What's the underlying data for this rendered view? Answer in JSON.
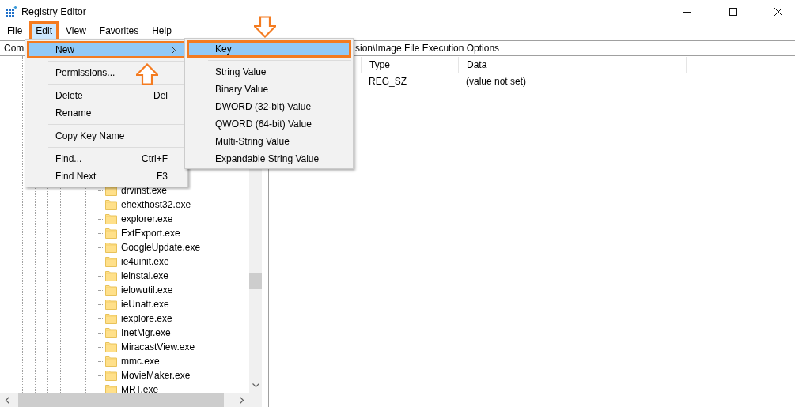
{
  "window": {
    "title": "Registry Editor"
  },
  "menu_bar": [
    {
      "label": "File",
      "selected": false,
      "annotated": false
    },
    {
      "label": "Edit",
      "selected": true,
      "annotated": true
    },
    {
      "label": "View",
      "selected": false,
      "annotated": false
    },
    {
      "label": "Favorites",
      "selected": false,
      "annotated": false
    },
    {
      "label": "Help",
      "selected": false,
      "annotated": false
    }
  ],
  "address_bar": {
    "visible_start": "Com",
    "visible_end": "sion\\Image File Execution Options"
  },
  "tree": {
    "items": [
      {
        "label": "drvinst.exe"
      },
      {
        "label": "ehexthost32.exe"
      },
      {
        "label": "explorer.exe"
      },
      {
        "label": "ExtExport.exe"
      },
      {
        "label": "GoogleUpdate.exe"
      },
      {
        "label": "ie4uinit.exe"
      },
      {
        "label": "ieinstal.exe"
      },
      {
        "label": "ielowutil.exe"
      },
      {
        "label": "ieUnatt.exe"
      },
      {
        "label": "iexplore.exe"
      },
      {
        "label": "InetMgr.exe"
      },
      {
        "label": "MiracastView.exe"
      },
      {
        "label": "mmc.exe"
      },
      {
        "label": "MovieMaker.exe"
      },
      {
        "label": "MRT.exe"
      }
    ]
  },
  "values": {
    "columns": [
      "Type",
      "Data"
    ],
    "rows": [
      [
        "REG_SZ",
        "(value not set)"
      ]
    ]
  },
  "edit_menu": {
    "items": [
      {
        "kind": "item",
        "label": "New",
        "has_submenu": true,
        "selected": true,
        "annotated": true
      },
      {
        "kind": "separator"
      },
      {
        "kind": "item",
        "label": "Permissions...",
        "selected": false,
        "annotated": false
      },
      {
        "kind": "separator"
      },
      {
        "kind": "item",
        "label": "Delete",
        "shortcut": "Del",
        "selected": false,
        "annotated": false
      },
      {
        "kind": "item",
        "label": "Rename",
        "selected": false,
        "annotated": false
      },
      {
        "kind": "separator"
      },
      {
        "kind": "item",
        "label": "Copy Key Name",
        "selected": false,
        "annotated": false
      },
      {
        "kind": "separator"
      },
      {
        "kind": "item",
        "label": "Find...",
        "shortcut": "Ctrl+F",
        "selected": false,
        "annotated": false
      },
      {
        "kind": "item",
        "label": "Find Next",
        "shortcut": "F3",
        "selected": false,
        "annotated": false
      }
    ]
  },
  "new_submenu": {
    "items": [
      {
        "kind": "item",
        "label": "Key",
        "selected": true,
        "annotated": true
      },
      {
        "kind": "separator"
      },
      {
        "kind": "item",
        "label": "String Value",
        "selected": false,
        "annotated": false
      },
      {
        "kind": "item",
        "label": "Binary Value",
        "selected": false,
        "annotated": false
      },
      {
        "kind": "item",
        "label": "DWORD (32-bit) Value",
        "selected": false,
        "annotated": false
      },
      {
        "kind": "item",
        "label": "QWORD (64-bit) Value",
        "selected": false,
        "annotated": false
      },
      {
        "kind": "item",
        "label": "Multi-String Value",
        "selected": false,
        "annotated": false
      },
      {
        "kind": "item",
        "label": "Expandable String Value",
        "selected": false,
        "annotated": false
      }
    ]
  }
}
